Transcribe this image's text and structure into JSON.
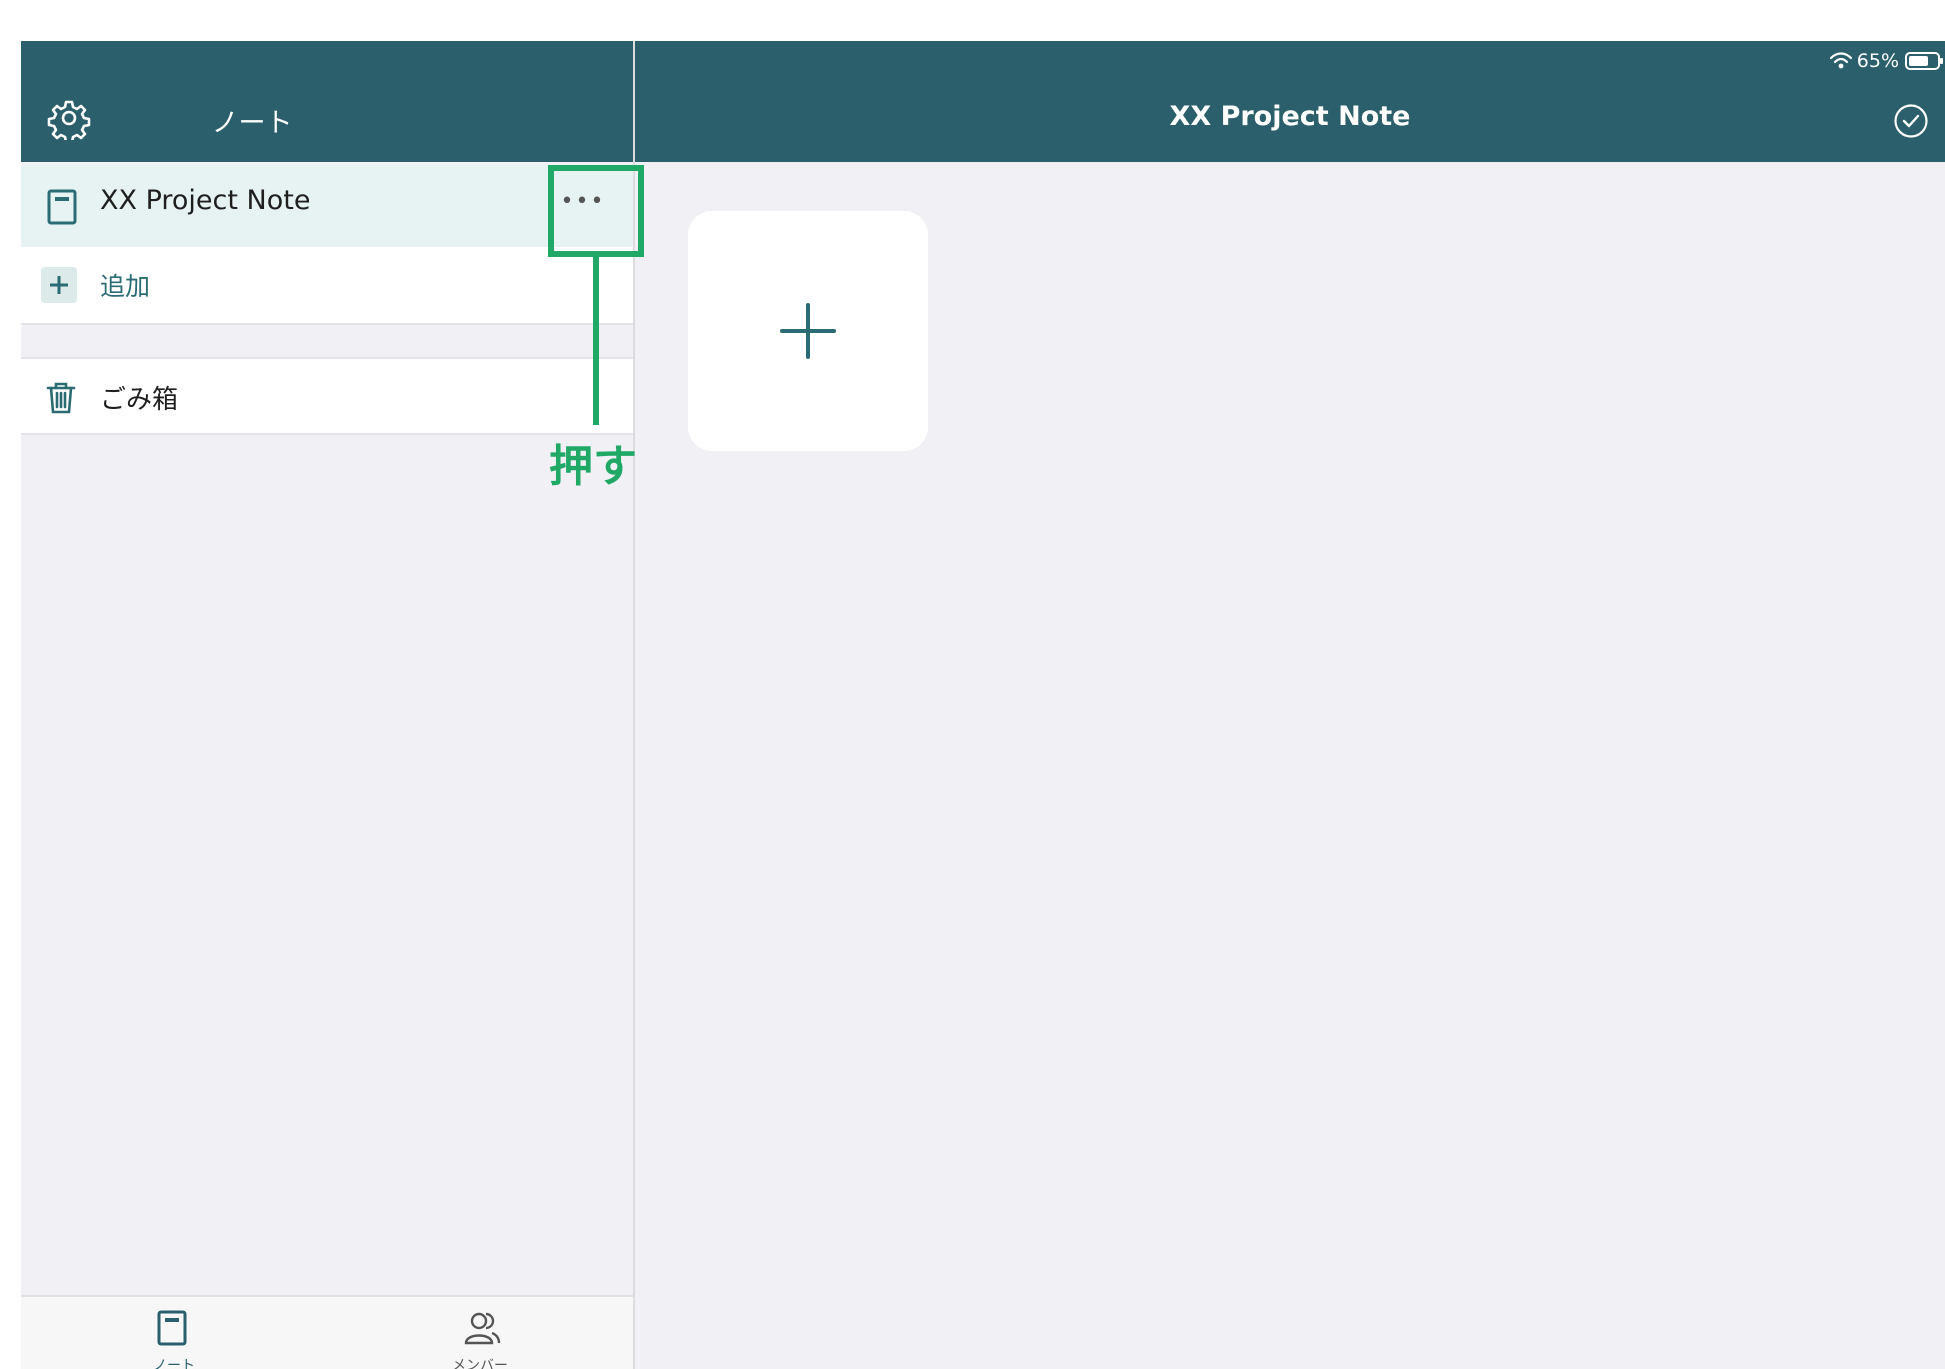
{
  "sidebar": {
    "header": {
      "title": "ノート",
      "settings_icon": "gear-icon"
    },
    "notes": [
      {
        "title": "XX Project Note",
        "icon": "notebook-icon",
        "more_label": "•••"
      }
    ],
    "add_label": "追加",
    "trash_label": "ごみ箱"
  },
  "tabbar": {
    "tabs": [
      {
        "label": "ノート",
        "icon": "notebook-icon",
        "selected": true
      },
      {
        "label": "メンバー",
        "icon": "members-icon",
        "selected": false
      }
    ]
  },
  "main": {
    "title": "XX Project Note",
    "check_icon": "checkmark-circle-icon",
    "add_page_icon": "plus-icon"
  },
  "status_bar": {
    "battery": "65%"
  },
  "annotation": {
    "label": "押す",
    "color": "#1fa866"
  },
  "colors": {
    "header": "#2a5f6b",
    "accent": "#2a6b74",
    "selected_row": "#e7f3f2",
    "background": "#f1f0f5"
  }
}
